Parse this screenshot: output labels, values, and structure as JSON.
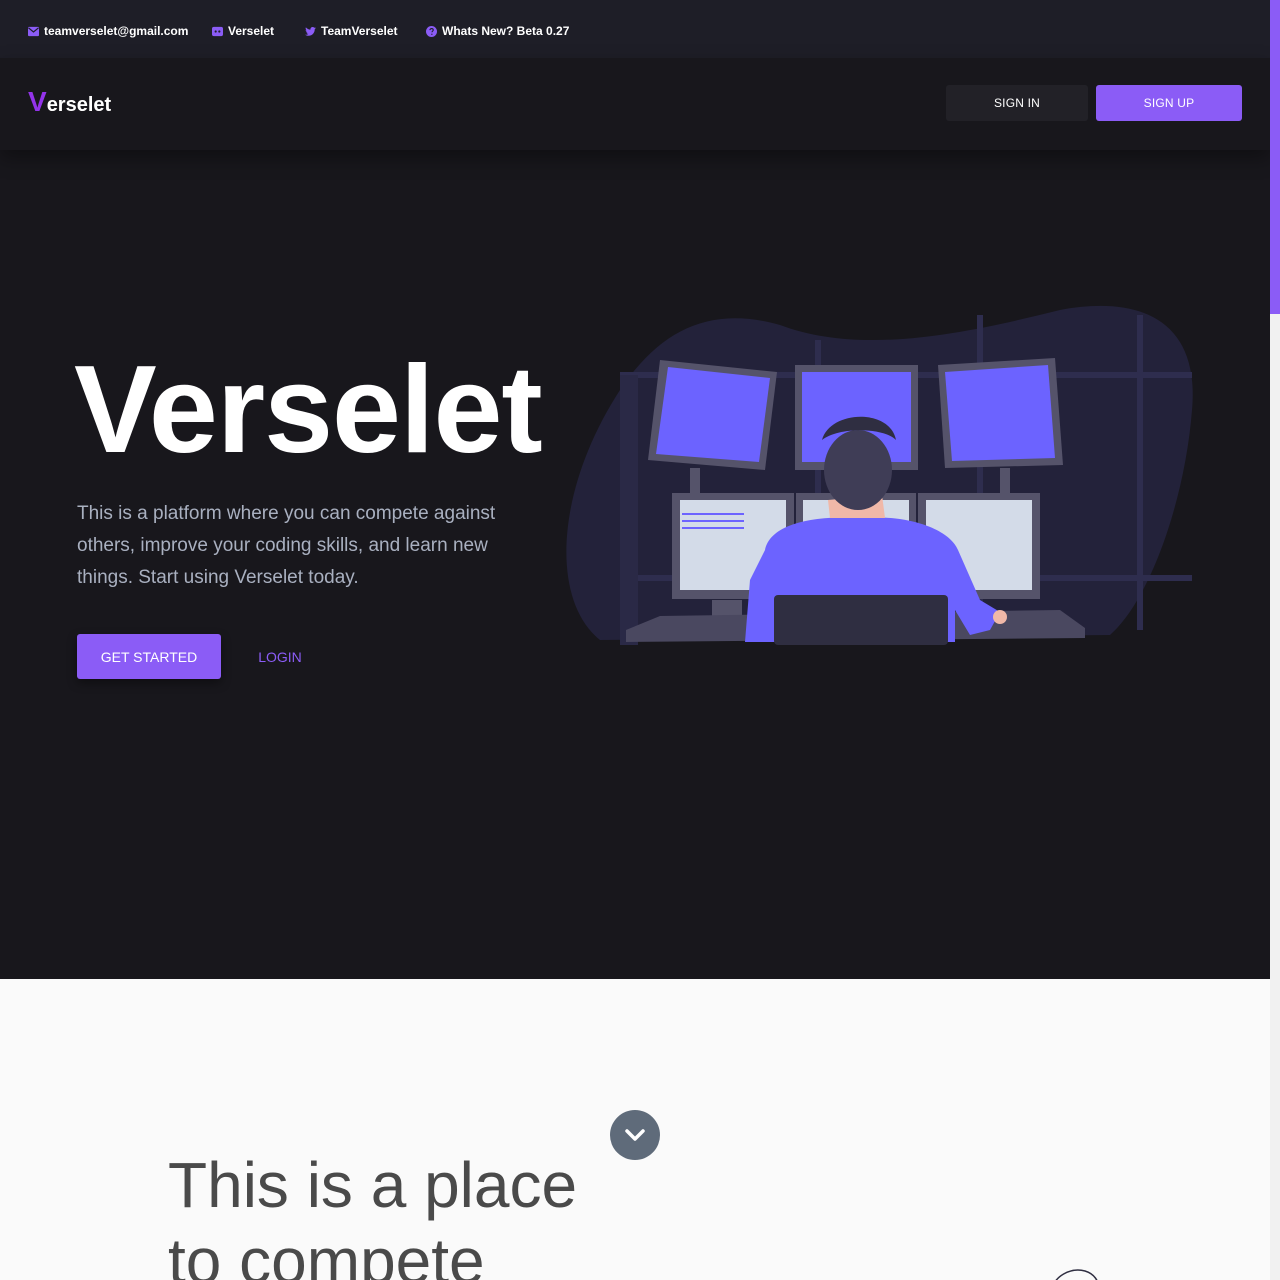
{
  "topbar": {
    "email": "teamverselet@gmail.com",
    "discord": "Verselet",
    "twitter": "TeamVerselet",
    "whats_new": "Whats New? Beta 0.27",
    "icons": [
      "envelope-icon",
      "discord-icon",
      "twitter-icon",
      "question-circle-icon"
    ]
  },
  "navbar": {
    "logo_letter": "V",
    "logo_rest": "erselet",
    "signin_label": "SIGN IN",
    "signup_label": "SIGN UP"
  },
  "hero": {
    "title": "Verselet",
    "description": "This is a platform where you can compete against others, improve your coding skills, and learn new things. Start using Verselet today.",
    "get_started_label": "GET STARTED",
    "login_label": "LOGIN"
  },
  "section2": {
    "title": "This is a place to compete",
    "scroll_icon": "chevron-down-icon"
  },
  "colors": {
    "accent": "#8b5cf6",
    "logo_accent": "#9333ea",
    "background_dark": "#18171c",
    "topbar_bg": "#1e1e27",
    "section_light": "#fafafa"
  }
}
